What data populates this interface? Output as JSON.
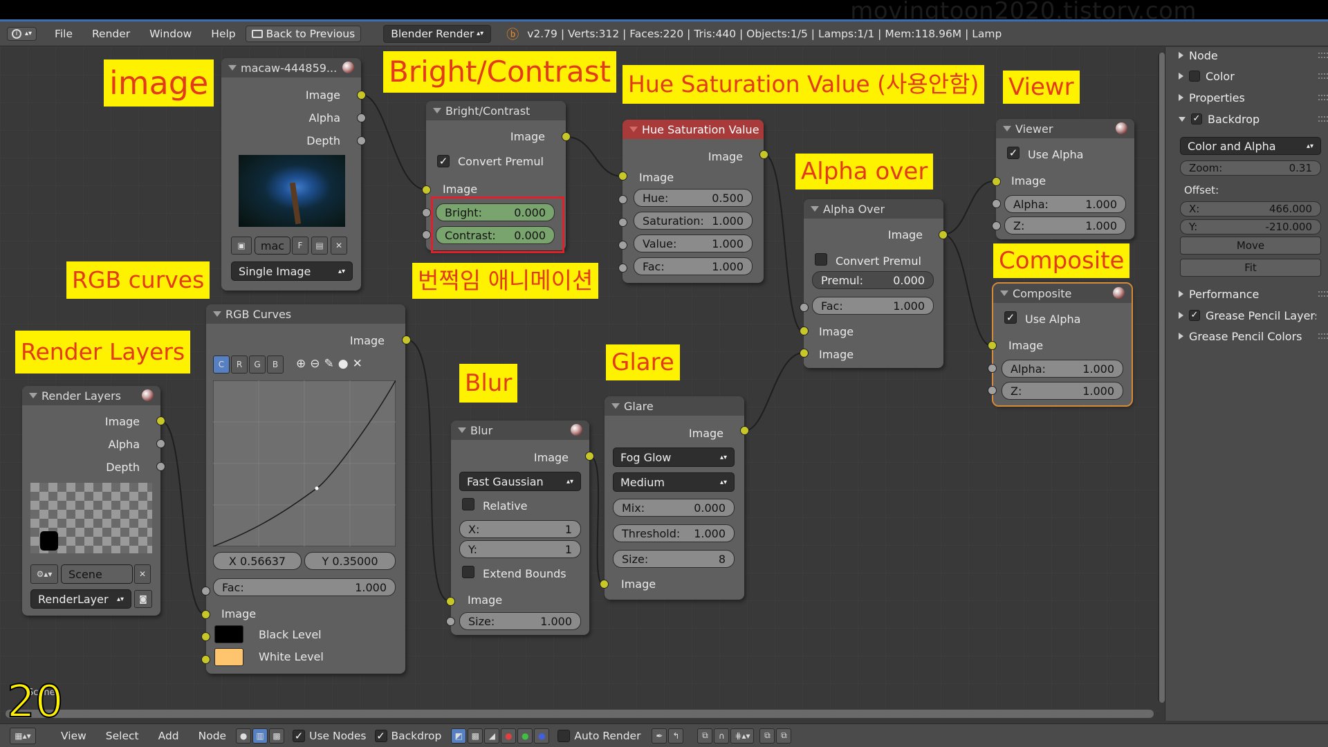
{
  "watermark": "movingtoon2020.tistory.com",
  "info_header": {
    "menus": [
      "File",
      "Render",
      "Window",
      "Help"
    ],
    "back_button": "Back to Previous",
    "render_engine": "Blender Render",
    "stats": "v2.79 | Verts:312 | Faces:220 | Tris:440 | Objects:1/5 | Lamps:1/1 | Mem:118.96M | Lamp"
  },
  "annotations": {
    "image": "image",
    "bright_contrast": "Bright/Contrast",
    "hsv": "Hue Saturation Value (사용안함)",
    "viewer": "Viewr",
    "alpha_over": "Alpha over",
    "composite": "Composite",
    "rgb_curves": "RGB curves",
    "flash_anim": "번쩍임 애니메이션",
    "render_layers": "Render Layers",
    "blur": "Blur",
    "glare": "Glare"
  },
  "nodes": {
    "image": {
      "title": "macaw-444859...",
      "outputs": [
        "Image",
        "Alpha",
        "Depth"
      ],
      "file_short": "mac",
      "file_flag": "F",
      "source": "Single Image"
    },
    "bright_contrast": {
      "title": "Bright/Contrast",
      "output": "Image",
      "convert_premul": "Convert Premul",
      "input": "Image",
      "bright_label": "Bright:",
      "bright": "0.000",
      "contrast_label": "Contrast:",
      "contrast": "0.000"
    },
    "hsv": {
      "title": "Hue Saturation Value",
      "output": "Image",
      "input": "Image",
      "hue_label": "Hue:",
      "hue": "0.500",
      "sat_label": "Saturation:",
      "sat": "1.000",
      "val_label": "Value:",
      "val": "1.000",
      "fac_label": "Fac:",
      "fac": "1.000"
    },
    "alpha_over": {
      "title": "Alpha Over",
      "output": "Image",
      "convert_premul": "Convert Premul",
      "premul_label": "Premul:",
      "premul": "0.000",
      "fac_label": "Fac:",
      "fac": "1.000",
      "input1": "Image",
      "input2": "Image"
    },
    "viewer": {
      "title": "Viewer",
      "use_alpha": "Use Alpha",
      "input": "Image",
      "alpha_label": "Alpha:",
      "alpha": "1.000",
      "z_label": "Z:",
      "z": "1.000"
    },
    "composite": {
      "title": "Composite",
      "use_alpha": "Use Alpha",
      "input": "Image",
      "alpha_label": "Alpha:",
      "alpha": "1.000",
      "z_label": "Z:",
      "z": "1.000"
    },
    "rgb_curves": {
      "title": "RGB Curves",
      "output": "Image",
      "channels": [
        "C",
        "R",
        "G",
        "B"
      ],
      "x_label": "X 0.56637",
      "y_label": "Y 0.35000",
      "fac_label": "Fac:",
      "fac": "1.000",
      "input": "Image",
      "black_level": "Black Level",
      "white_level": "White Level",
      "black_color": "#000000",
      "white_color": "#ffc46e"
    },
    "render_layers": {
      "title": "Render Layers",
      "outputs": [
        "Image",
        "Alpha",
        "Depth"
      ],
      "scene": "Scene",
      "layer": "RenderLayer"
    },
    "blur": {
      "title": "Blur",
      "output": "Image",
      "filter": "Fast Gaussian",
      "relative": "Relative",
      "x_label": "X:",
      "x": "1",
      "y_label": "Y:",
      "y": "1",
      "extend_bounds": "Extend Bounds",
      "input": "Image",
      "size_label": "Size:",
      "size": "1.000"
    },
    "glare": {
      "title": "Glare",
      "output": "Image",
      "type": "Fog Glow",
      "quality": "Medium",
      "mix_label": "Mix:",
      "mix": "0.000",
      "threshold_label": "Threshold:",
      "threshold": "1.000",
      "size_label": "Size:",
      "size": "8",
      "input": "Image"
    }
  },
  "right_panel": {
    "sections": [
      "Node",
      "Color",
      "Properties",
      "Backdrop"
    ],
    "backdrop_mode": "Color and Alpha",
    "zoom_label": "Zoom:",
    "zoom": "0.31",
    "offset_label": "Offset:",
    "x_label": "X:",
    "x": "466.000",
    "y_label": "Y:",
    "y": "-210.000",
    "move": "Move",
    "fit": "Fit",
    "sections_after": [
      "Performance",
      "Grease Pencil Layers",
      "Grease Pencil Colors"
    ]
  },
  "bottom_header": {
    "menus": [
      "View",
      "Select",
      "Add",
      "Node"
    ],
    "use_nodes": "Use Nodes",
    "backdrop": "Backdrop",
    "auto_render": "Auto Render"
  },
  "scene_label": "Scene",
  "frame_number": "20"
}
